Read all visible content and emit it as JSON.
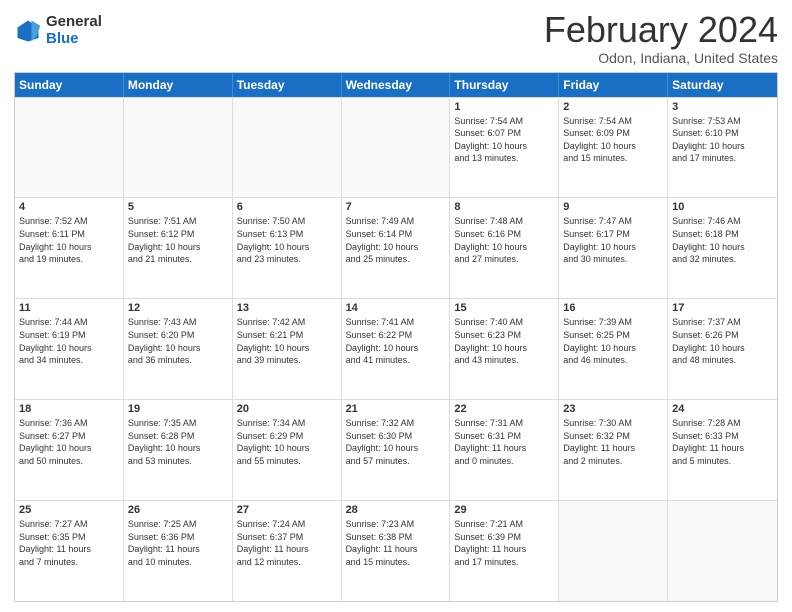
{
  "header": {
    "logo_general": "General",
    "logo_blue": "Blue",
    "title": "February 2024",
    "subtitle": "Odon, Indiana, United States"
  },
  "days_of_week": [
    "Sunday",
    "Monday",
    "Tuesday",
    "Wednesday",
    "Thursday",
    "Friday",
    "Saturday"
  ],
  "weeks": [
    [
      {
        "day": "",
        "info": ""
      },
      {
        "day": "",
        "info": ""
      },
      {
        "day": "",
        "info": ""
      },
      {
        "day": "",
        "info": ""
      },
      {
        "day": "1",
        "info": "Sunrise: 7:54 AM\nSunset: 6:07 PM\nDaylight: 10 hours\nand 13 minutes."
      },
      {
        "day": "2",
        "info": "Sunrise: 7:54 AM\nSunset: 6:09 PM\nDaylight: 10 hours\nand 15 minutes."
      },
      {
        "day": "3",
        "info": "Sunrise: 7:53 AM\nSunset: 6:10 PM\nDaylight: 10 hours\nand 17 minutes."
      }
    ],
    [
      {
        "day": "4",
        "info": "Sunrise: 7:52 AM\nSunset: 6:11 PM\nDaylight: 10 hours\nand 19 minutes."
      },
      {
        "day": "5",
        "info": "Sunrise: 7:51 AM\nSunset: 6:12 PM\nDaylight: 10 hours\nand 21 minutes."
      },
      {
        "day": "6",
        "info": "Sunrise: 7:50 AM\nSunset: 6:13 PM\nDaylight: 10 hours\nand 23 minutes."
      },
      {
        "day": "7",
        "info": "Sunrise: 7:49 AM\nSunset: 6:14 PM\nDaylight: 10 hours\nand 25 minutes."
      },
      {
        "day": "8",
        "info": "Sunrise: 7:48 AM\nSunset: 6:16 PM\nDaylight: 10 hours\nand 27 minutes."
      },
      {
        "day": "9",
        "info": "Sunrise: 7:47 AM\nSunset: 6:17 PM\nDaylight: 10 hours\nand 30 minutes."
      },
      {
        "day": "10",
        "info": "Sunrise: 7:46 AM\nSunset: 6:18 PM\nDaylight: 10 hours\nand 32 minutes."
      }
    ],
    [
      {
        "day": "11",
        "info": "Sunrise: 7:44 AM\nSunset: 6:19 PM\nDaylight: 10 hours\nand 34 minutes."
      },
      {
        "day": "12",
        "info": "Sunrise: 7:43 AM\nSunset: 6:20 PM\nDaylight: 10 hours\nand 36 minutes."
      },
      {
        "day": "13",
        "info": "Sunrise: 7:42 AM\nSunset: 6:21 PM\nDaylight: 10 hours\nand 39 minutes."
      },
      {
        "day": "14",
        "info": "Sunrise: 7:41 AM\nSunset: 6:22 PM\nDaylight: 10 hours\nand 41 minutes."
      },
      {
        "day": "15",
        "info": "Sunrise: 7:40 AM\nSunset: 6:23 PM\nDaylight: 10 hours\nand 43 minutes."
      },
      {
        "day": "16",
        "info": "Sunrise: 7:39 AM\nSunset: 6:25 PM\nDaylight: 10 hours\nand 46 minutes."
      },
      {
        "day": "17",
        "info": "Sunrise: 7:37 AM\nSunset: 6:26 PM\nDaylight: 10 hours\nand 48 minutes."
      }
    ],
    [
      {
        "day": "18",
        "info": "Sunrise: 7:36 AM\nSunset: 6:27 PM\nDaylight: 10 hours\nand 50 minutes."
      },
      {
        "day": "19",
        "info": "Sunrise: 7:35 AM\nSunset: 6:28 PM\nDaylight: 10 hours\nand 53 minutes."
      },
      {
        "day": "20",
        "info": "Sunrise: 7:34 AM\nSunset: 6:29 PM\nDaylight: 10 hours\nand 55 minutes."
      },
      {
        "day": "21",
        "info": "Sunrise: 7:32 AM\nSunset: 6:30 PM\nDaylight: 10 hours\nand 57 minutes."
      },
      {
        "day": "22",
        "info": "Sunrise: 7:31 AM\nSunset: 6:31 PM\nDaylight: 11 hours\nand 0 minutes."
      },
      {
        "day": "23",
        "info": "Sunrise: 7:30 AM\nSunset: 6:32 PM\nDaylight: 11 hours\nand 2 minutes."
      },
      {
        "day": "24",
        "info": "Sunrise: 7:28 AM\nSunset: 6:33 PM\nDaylight: 11 hours\nand 5 minutes."
      }
    ],
    [
      {
        "day": "25",
        "info": "Sunrise: 7:27 AM\nSunset: 6:35 PM\nDaylight: 11 hours\nand 7 minutes."
      },
      {
        "day": "26",
        "info": "Sunrise: 7:25 AM\nSunset: 6:36 PM\nDaylight: 11 hours\nand 10 minutes."
      },
      {
        "day": "27",
        "info": "Sunrise: 7:24 AM\nSunset: 6:37 PM\nDaylight: 11 hours\nand 12 minutes."
      },
      {
        "day": "28",
        "info": "Sunrise: 7:23 AM\nSunset: 6:38 PM\nDaylight: 11 hours\nand 15 minutes."
      },
      {
        "day": "29",
        "info": "Sunrise: 7:21 AM\nSunset: 6:39 PM\nDaylight: 11 hours\nand 17 minutes."
      },
      {
        "day": "",
        "info": ""
      },
      {
        "day": "",
        "info": ""
      }
    ]
  ]
}
